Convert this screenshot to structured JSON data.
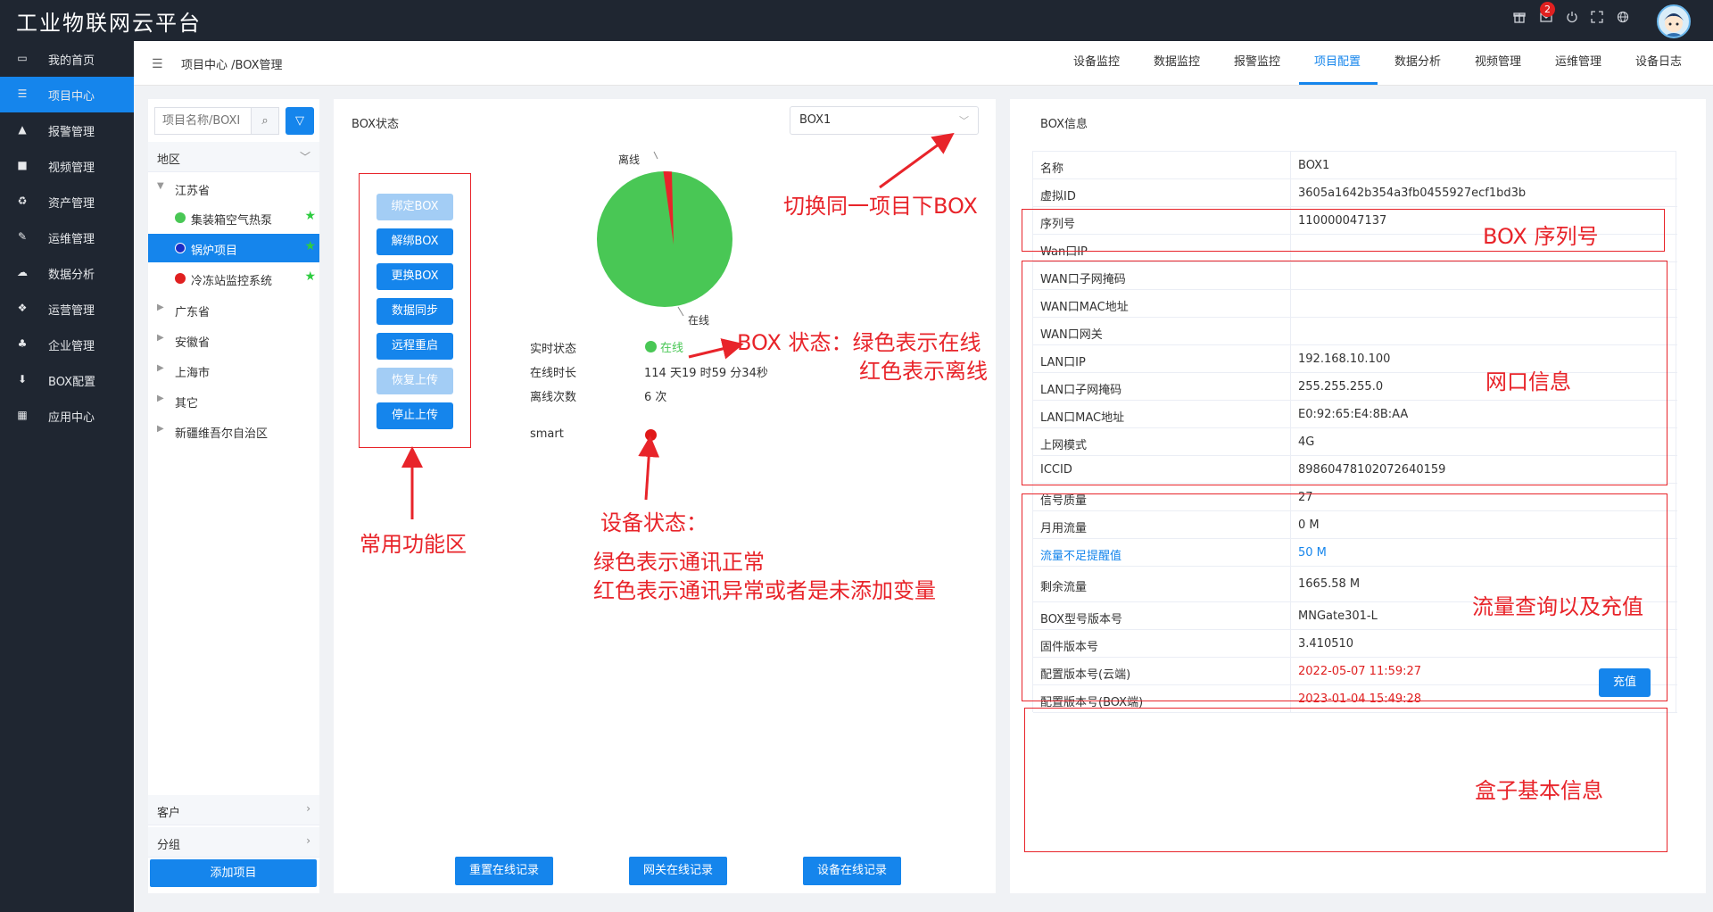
{
  "app": {
    "title": "工业物联网云平台",
    "mail_count": "2"
  },
  "sidebar": {
    "items": [
      {
        "label": "我的首页",
        "icon": "laptop-icon"
      },
      {
        "label": "项目中心",
        "icon": "list-icon"
      },
      {
        "label": "报警管理",
        "icon": "bell-icon"
      },
      {
        "label": "视频管理",
        "icon": "video-icon"
      },
      {
        "label": "资产管理",
        "icon": "recycle-icon"
      },
      {
        "label": "运维管理",
        "icon": "wrench-icon"
      },
      {
        "label": "数据分析",
        "icon": "cloud-icon"
      },
      {
        "label": "运营管理",
        "icon": "cubes-icon"
      },
      {
        "label": "企业管理",
        "icon": "sitemap-icon"
      },
      {
        "label": "BOX配置",
        "icon": "download-icon"
      },
      {
        "label": "应用中心",
        "icon": "grid-icon"
      }
    ]
  },
  "header": {
    "breadcrumb": "项目中心 /BOX管理",
    "tabs": [
      "设备监控",
      "数据监控",
      "报警监控",
      "项目配置",
      "数据分析",
      "视频管理",
      "运维管理",
      "设备日志"
    ]
  },
  "tree": {
    "search_placeholder": "项目名称/BOXI",
    "region_label": "地区",
    "nodes": [
      "江苏省",
      "广东省",
      "安徽省",
      "上海市",
      "其它",
      "新疆维吾尔自治区"
    ],
    "leaves": [
      {
        "label": "集装箱空气热泵",
        "status": "green"
      },
      {
        "label": "锅炉项目",
        "status": "blue"
      },
      {
        "label": "冷冻站监控系统",
        "status": "red"
      }
    ],
    "customer_label": "客户",
    "group_label": "分组",
    "add_button": "添加项目"
  },
  "status_panel": {
    "title": "BOX状态",
    "box_selected": "BOX1",
    "buttons": [
      {
        "label": "绑定BOX",
        "disabled": true
      },
      {
        "label": "解绑BOX",
        "disabled": false
      },
      {
        "label": "更换BOX",
        "disabled": false
      },
      {
        "label": "数据同步",
        "disabled": false
      },
      {
        "label": "远程重启",
        "disabled": false
      },
      {
        "label": "恢复上传",
        "disabled": true
      },
      {
        "label": "停止上传",
        "disabled": false
      }
    ],
    "pie": {
      "offline_label": "离线",
      "online_label": "在线",
      "offline_fraction": 0.02,
      "online_color": "#49c755",
      "offline_color": "#e8242a"
    },
    "realtime_label": "实时状态",
    "realtime_value": "在线",
    "online_duration_label": "在线时长",
    "online_duration_value": "114 天19 时59 分34秒",
    "offline_count_label": "离线次数",
    "offline_count_value": "6 次",
    "device_name": "smart",
    "bottom_buttons": [
      "重置在线记录",
      "网关在线记录",
      "设备在线记录"
    ]
  },
  "annotations": {
    "switch_box": "切换同一项目下BOX",
    "box_status_line1": "BOX 状态：绿色表示在线",
    "box_status_line2": "红色表示离线",
    "common_functions": "常用功能区",
    "device_status_title": "设备状态：",
    "device_status_line1": "绿色表示通讯正常",
    "device_status_line2": "红色表示通讯异常或者是未添加变量",
    "serial": "BOX 序列号",
    "network": "网口信息",
    "traffic": "流量查询以及充值",
    "basic_info": "盒子基本信息"
  },
  "info_panel": {
    "title": "BOX信息",
    "rows": [
      {
        "k": "名称",
        "v": "BOX1"
      },
      {
        "k": "虚拟ID",
        "v": "3605a1642b354a3fb0455927ecf1bd3b"
      },
      {
        "k": "序列号",
        "v": "110000047137"
      },
      {
        "k": "Wan口IP",
        "v": ""
      },
      {
        "k": "WAN口子网掩码",
        "v": ""
      },
      {
        "k": "WAN口MAC地址",
        "v": ""
      },
      {
        "k": "WAN口网关",
        "v": ""
      },
      {
        "k": "LAN口IP",
        "v": "192.168.10.100"
      },
      {
        "k": "LAN口子网掩码",
        "v": "255.255.255.0"
      },
      {
        "k": "LAN口MAC地址",
        "v": "E0:92:65:E4:8B:AA"
      },
      {
        "k": "上网模式",
        "v": "4G"
      },
      {
        "k": "ICCID",
        "v": "89860478102072640159"
      },
      {
        "k": "信号质量",
        "v": "27"
      },
      {
        "k": "月用流量",
        "v": "0 M"
      },
      {
        "k": "流量不足提醒值",
        "v": "50  M"
      },
      {
        "k": "剩余流量",
        "v": "1665.58 M"
      },
      {
        "k": "BOX型号版本号",
        "v": "MNGate301-L"
      },
      {
        "k": "固件版本号",
        "v": "3.410510"
      },
      {
        "k": "配置版本号(云端)",
        "v": "2022-05-07 11:59:27"
      },
      {
        "k": "配置版本号(BOX端)",
        "v": "2023-01-04 15:49:28"
      }
    ],
    "recharge_button": "充值"
  }
}
